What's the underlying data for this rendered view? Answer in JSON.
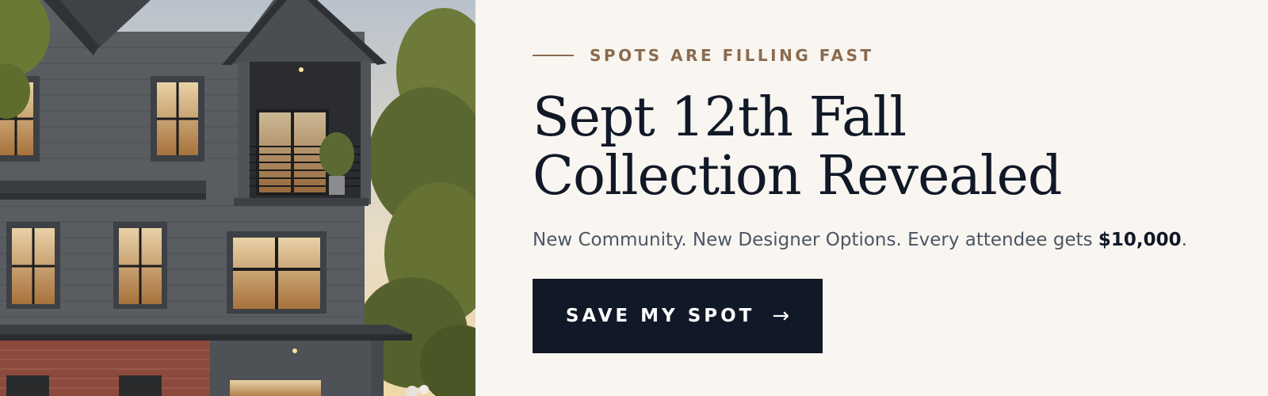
{
  "hero": {
    "eyebrow": "SPOTS ARE FILLING FAST",
    "headline": "Sept 12th Fall Collection Revealed",
    "subline_text": "New Community. New Designer Options. Every attendee gets ",
    "subline_amount": "$10,000",
    "subline_end": ".",
    "cta_label": "SAVE MY SPOT",
    "cta_icon": "arrow-right-icon"
  },
  "colors": {
    "background": "#f9f6f1",
    "accent": "#8b6a4f",
    "dark": "#111827",
    "body_text": "#4b5563"
  }
}
